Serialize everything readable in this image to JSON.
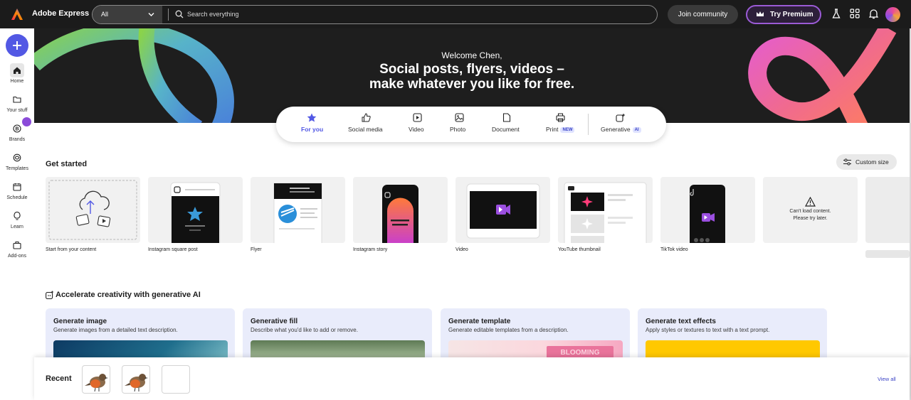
{
  "header": {
    "app_name": "Adobe Express",
    "search_scope": "All",
    "search_placeholder": "Search everything",
    "join_label": "Join community",
    "premium_label": "Try Premium"
  },
  "sidebar": {
    "items": [
      {
        "label": "Home",
        "icon": "home-icon"
      },
      {
        "label": "Your stuff",
        "icon": "folder-icon"
      },
      {
        "label": "Brands",
        "icon": "brand-icon"
      },
      {
        "label": "Templates",
        "icon": "templates-icon"
      },
      {
        "label": "Schedule",
        "icon": "calendar-icon"
      },
      {
        "label": "Learn",
        "icon": "lightbulb-icon"
      },
      {
        "label": "Add-ons",
        "icon": "addons-icon"
      }
    ]
  },
  "hero": {
    "welcome": "Welcome Chen,",
    "headline_line1": "Social posts, flyers, videos –",
    "headline_line2": "make whatever you like for free."
  },
  "tabs": [
    {
      "label": "For you",
      "icon": "star-icon",
      "active": true
    },
    {
      "label": "Social media",
      "icon": "thumbs-up-icon"
    },
    {
      "label": "Video",
      "icon": "play-icon"
    },
    {
      "label": "Photo",
      "icon": "photo-icon"
    },
    {
      "label": "Document",
      "icon": "document-icon"
    },
    {
      "label": "Print",
      "icon": "print-icon",
      "badge": "NEW"
    },
    {
      "label": "Generative",
      "icon": "generative-icon",
      "badge": "AI"
    }
  ],
  "get_started": {
    "title": "Get started",
    "custom_size": "Custom size",
    "cards": [
      {
        "label": "Start from your content"
      },
      {
        "label": "Instagram square post"
      },
      {
        "label": "Flyer"
      },
      {
        "label": "Instagram story"
      },
      {
        "label": "Video"
      },
      {
        "label": "YouTube thumbnail"
      },
      {
        "label": "TikTok video"
      }
    ],
    "error_line1": "Can't load content.",
    "error_line2": "Please try later."
  },
  "generative": {
    "title": "Accelerate creativity with generative AI",
    "cards": [
      {
        "title": "Generate image",
        "desc": "Generate images from a detailed text description."
      },
      {
        "title": "Generative fill",
        "desc": "Describe what you'd like to add or remove."
      },
      {
        "title": "Generate template",
        "desc": "Generate editable templates from a description."
      },
      {
        "title": "Generate text effects",
        "desc": "Apply styles or textures to text with a text prompt."
      }
    ],
    "template_thumb_text": "BLOOMING"
  },
  "recent": {
    "title": "Recent",
    "view_all": "View all"
  },
  "colors": {
    "accent": "#5258e4",
    "topbar": "#1b1b1b",
    "hero": "#1e1e1e",
    "premium_border": "#9b5bd6"
  }
}
